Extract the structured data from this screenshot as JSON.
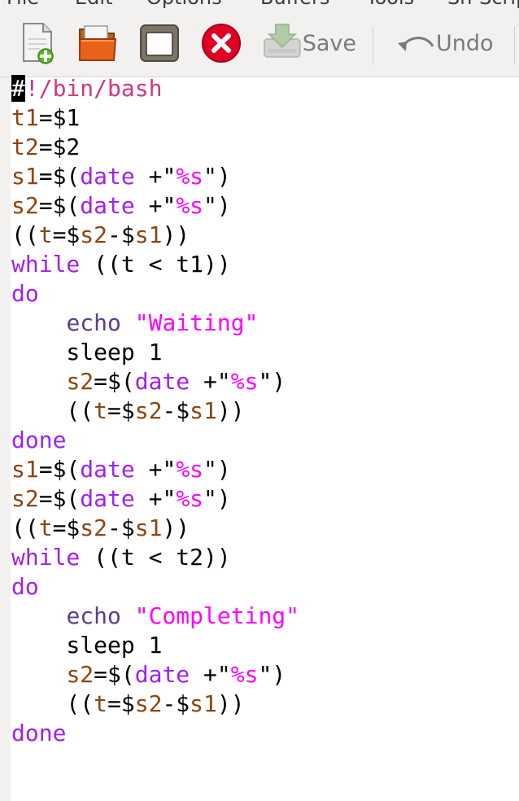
{
  "colors": {
    "comment": "#d33682",
    "var": "#8b4513",
    "keyword": "#a020f0",
    "builtin": "#5a3e8c",
    "string": "#ff00ff",
    "text": "#000000"
  },
  "menu": [
    "File",
    "Edit",
    "Options",
    "Buffers",
    "Tools",
    "Sh-Script"
  ],
  "toolbar": {
    "new_icon": "new-file-icon",
    "open_icon": "open-folder-icon",
    "dired_icon": "window-icon",
    "close_icon": "close-icon",
    "save_label": "Save",
    "undo_label": "Undo"
  },
  "code_lines": [
    [
      [
        "#",
        "cursor"
      ],
      [
        "!/bin/bash",
        "comment"
      ]
    ],
    [
      [
        "t1",
        "var"
      ],
      [
        "=$1",
        "plain"
      ]
    ],
    [
      [
        "t2",
        "var"
      ],
      [
        "=$2",
        "plain"
      ]
    ],
    [
      [
        "s1",
        "var"
      ],
      [
        "=$(",
        "plain"
      ],
      [
        "date",
        "keyword"
      ],
      [
        " +\"",
        "plain"
      ],
      [
        "%s",
        "string"
      ],
      [
        "\")",
        "plain"
      ]
    ],
    [
      [
        "s2",
        "var"
      ],
      [
        "=$(",
        "plain"
      ],
      [
        "date",
        "keyword"
      ],
      [
        " +\"",
        "plain"
      ],
      [
        "%s",
        "string"
      ],
      [
        "\")",
        "plain"
      ]
    ],
    [
      [
        "((",
        "plain"
      ],
      [
        "t",
        "var"
      ],
      [
        "=$",
        "plain"
      ],
      [
        "s2",
        "var"
      ],
      [
        "-$",
        "plain"
      ],
      [
        "s1",
        "var"
      ],
      [
        "))",
        "plain"
      ]
    ],
    [
      [
        "while",
        "keyword"
      ],
      [
        " ((t < t1))",
        "plain"
      ]
    ],
    [
      [
        "do",
        "keyword"
      ]
    ],
    [
      [
        "    ",
        "plain"
      ],
      [
        "echo",
        "builtin"
      ],
      [
        " ",
        "plain"
      ],
      [
        "\"Waiting\"",
        "string"
      ]
    ],
    [
      [
        "    sleep 1",
        "plain"
      ]
    ],
    [
      [
        "    ",
        "plain"
      ],
      [
        "s2",
        "var"
      ],
      [
        "=$(",
        "plain"
      ],
      [
        "date",
        "keyword"
      ],
      [
        " +\"",
        "plain"
      ],
      [
        "%s",
        "string"
      ],
      [
        "\")",
        "plain"
      ]
    ],
    [
      [
        "    ((",
        "plain"
      ],
      [
        "t",
        "var"
      ],
      [
        "=$",
        "plain"
      ],
      [
        "s2",
        "var"
      ],
      [
        "-$",
        "plain"
      ],
      [
        "s1",
        "var"
      ],
      [
        "))",
        "plain"
      ]
    ],
    [
      [
        "done",
        "keyword"
      ]
    ],
    [
      [
        "s1",
        "var"
      ],
      [
        "=$(",
        "plain"
      ],
      [
        "date",
        "keyword"
      ],
      [
        " +\"",
        "plain"
      ],
      [
        "%s",
        "string"
      ],
      [
        "\")",
        "plain"
      ]
    ],
    [
      [
        "s2",
        "var"
      ],
      [
        "=$(",
        "plain"
      ],
      [
        "date",
        "keyword"
      ],
      [
        " +\"",
        "plain"
      ],
      [
        "%s",
        "string"
      ],
      [
        "\")",
        "plain"
      ]
    ],
    [
      [
        "((",
        "plain"
      ],
      [
        "t",
        "var"
      ],
      [
        "=$",
        "plain"
      ],
      [
        "s2",
        "var"
      ],
      [
        "-$",
        "plain"
      ],
      [
        "s1",
        "var"
      ],
      [
        "))",
        "plain"
      ]
    ],
    [
      [
        "while",
        "keyword"
      ],
      [
        " ((t < t2))",
        "plain"
      ]
    ],
    [
      [
        "do",
        "keyword"
      ]
    ],
    [
      [
        "    ",
        "plain"
      ],
      [
        "echo",
        "builtin"
      ],
      [
        " ",
        "plain"
      ],
      [
        "\"Completing\"",
        "string"
      ]
    ],
    [
      [
        "    sleep 1",
        "plain"
      ]
    ],
    [
      [
        "    ",
        "plain"
      ],
      [
        "s2",
        "var"
      ],
      [
        "=$(",
        "plain"
      ],
      [
        "date",
        "keyword"
      ],
      [
        " +\"",
        "plain"
      ],
      [
        "%s",
        "string"
      ],
      [
        "\")",
        "plain"
      ]
    ],
    [
      [
        "    ((",
        "plain"
      ],
      [
        "t",
        "var"
      ],
      [
        "=$",
        "plain"
      ],
      [
        "s2",
        "var"
      ],
      [
        "-$",
        "plain"
      ],
      [
        "s1",
        "var"
      ],
      [
        "))",
        "plain"
      ]
    ],
    [
      [
        "done",
        "keyword"
      ]
    ]
  ]
}
